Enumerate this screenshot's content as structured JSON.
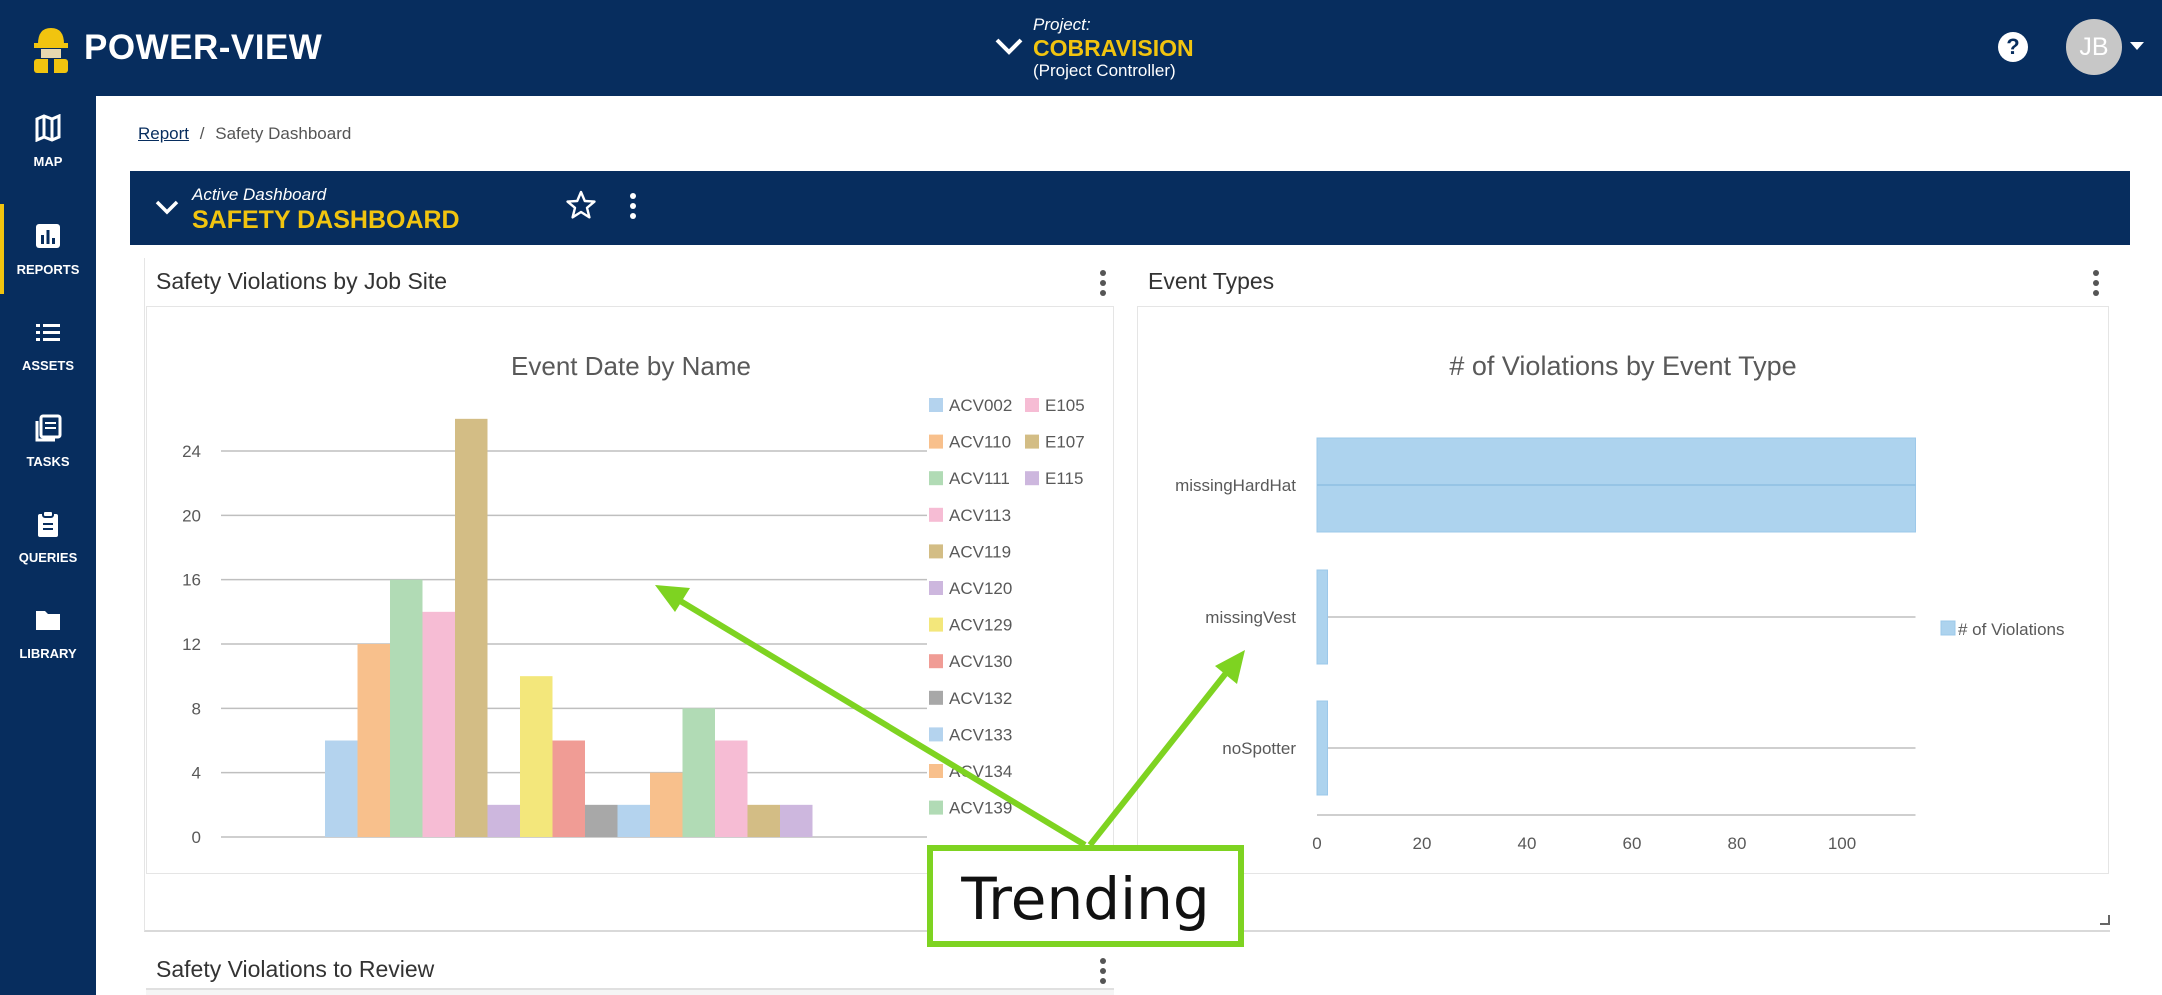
{
  "app": {
    "brand": "POWER-VIEW",
    "project_label": "Project:",
    "project_name": "COBRAVISION",
    "project_role": "(Project Controller)",
    "help_label": "?",
    "user_initials": "JB"
  },
  "sidebar": {
    "items": [
      {
        "label": "MAP",
        "icon": "map-icon"
      },
      {
        "label": "REPORTS",
        "icon": "bar-chart-icon",
        "active": true
      },
      {
        "label": "ASSETS",
        "icon": "list-icon"
      },
      {
        "label": "TASKS",
        "icon": "tasks-icon"
      },
      {
        "label": "QUERIES",
        "icon": "clipboard-icon"
      },
      {
        "label": "LIBRARY",
        "icon": "folder-icon"
      }
    ]
  },
  "breadcrumb": {
    "link": "Report",
    "separator": "/",
    "current": "Safety Dashboard"
  },
  "dashboard": {
    "label": "Active Dashboard",
    "title": "SAFETY DASHBOARD"
  },
  "panels": {
    "violations_by_site": {
      "title": "Safety Violations by Job Site"
    },
    "event_types": {
      "title": "Event Types"
    },
    "to_review": {
      "title": "Safety Violations to Review"
    }
  },
  "annotation": {
    "text": "Trending",
    "color": "#7ed321"
  },
  "colors": {
    "navy": "#072d5e",
    "accent": "#f1c40f"
  },
  "chart_data": [
    {
      "type": "bar",
      "title": "Event Date by Name",
      "xlabel": "",
      "ylabel": "",
      "ylim": [
        0,
        26
      ],
      "yticks": [
        0,
        4,
        8,
        12,
        16,
        20,
        24
      ],
      "grid": true,
      "legend_position": "right",
      "legend": [
        "ACV002",
        "E105",
        "ACV110",
        "E107",
        "ACV111",
        "E115",
        "ACV113",
        "ACV119",
        "ACV120",
        "ACV129",
        "ACV130",
        "ACV132",
        "ACV133",
        "ACV134",
        "ACV139"
      ],
      "bars": [
        {
          "name": "ACV002",
          "value": 6,
          "color": "#b4d3ee"
        },
        {
          "name": "ACV110",
          "value": 12,
          "color": "#f8c08c"
        },
        {
          "name": "ACV111",
          "value": 16,
          "color": "#b1dbb5"
        },
        {
          "name": "ACV113",
          "value": 14,
          "color": "#f6bcd4"
        },
        {
          "name": "ACV119",
          "value": 26,
          "color": "#d3bd85"
        },
        {
          "name": "ACV120",
          "value": 2,
          "color": "#cdb7de"
        },
        {
          "name": "ACV129",
          "value": 10,
          "color": "#f3e77b"
        },
        {
          "name": "ACV130",
          "value": 6,
          "color": "#f09c95"
        },
        {
          "name": "ACV132",
          "value": 2,
          "color": "#a8a8a8"
        },
        {
          "name": "ACV133",
          "value": 2,
          "color": "#b4d3ee"
        },
        {
          "name": "ACV134",
          "value": 4,
          "color": "#f8c08c"
        },
        {
          "name": "ACV139",
          "value": 8,
          "color": "#b1dbb5"
        },
        {
          "name": "E105",
          "value": 6,
          "color": "#f6bcd4"
        },
        {
          "name": "E107",
          "value": 2,
          "color": "#d3bd85"
        },
        {
          "name": "E115",
          "value": 2,
          "color": "#cdb7de"
        }
      ]
    },
    {
      "type": "bar",
      "orientation": "horizontal",
      "title": "# of Violations by Event Type",
      "categories": [
        "missingHardHat",
        "missingVest",
        "noSpotter"
      ],
      "series": [
        {
          "name": "# of Violations",
          "values": [
            114,
            2,
            2
          ],
          "color": "#add3ee"
        }
      ],
      "xlim": [
        0,
        114
      ],
      "xticks": [
        0,
        20,
        40,
        60,
        80,
        100
      ],
      "legend_position": "right"
    }
  ]
}
